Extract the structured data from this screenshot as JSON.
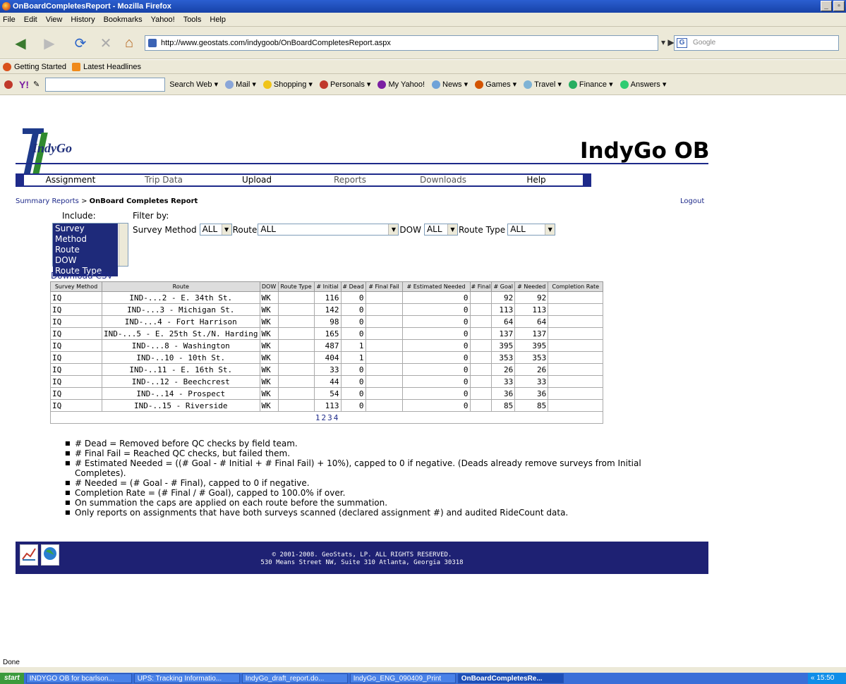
{
  "window": {
    "title": "OnBoardCompletesReport - Mozilla Firefox"
  },
  "menu": [
    "File",
    "Edit",
    "View",
    "History",
    "Bookmarks",
    "Yahoo!",
    "Tools",
    "Help"
  ],
  "toolbar": {
    "url": "http://www.geostats.com/indygoob/OnBoardCompletesReport.aspx",
    "search_placeholder": "Google"
  },
  "bookmarks": [
    "Getting Started",
    "Latest Headlines"
  ],
  "yahoo_toolbar": {
    "search_web": "Search Web",
    "items": [
      "Mail",
      "Shopping",
      "Personals",
      "My Yahoo!",
      "News",
      "Games",
      "Travel",
      "Finance",
      "Answers"
    ]
  },
  "site": {
    "logo_text": "IndyGo",
    "app_title": "IndyGo OB",
    "tabs": [
      "Assignment",
      "Trip Data",
      "Upload",
      "Reports",
      "Downloads",
      "Help"
    ]
  },
  "breadcrumb": {
    "parent": "Summary Reports",
    "sep": ">",
    "current": "OnBoard Completes Report"
  },
  "logout": "Logout",
  "include": {
    "label": "Include:",
    "options": [
      "Survey Method",
      "Route",
      "DOW",
      "Route Type"
    ]
  },
  "filter": {
    "label": "Filter by:",
    "survey_method_label": "Survey Method",
    "survey_method_value": "ALL",
    "route_label": "Route",
    "route_value": "ALL",
    "dow_label": "DOW",
    "dow_value": "ALL",
    "route_type_label": "Route Type",
    "route_type_value": "ALL"
  },
  "download_csv": "Download CSV",
  "table": {
    "headers": [
      "Survey Method",
      "Route",
      "DOW",
      "Route Type",
      "# Initial",
      "# Dead",
      "# Final Fail",
      "# Estimated Needed",
      "# Final",
      "# Goal",
      "# Needed",
      "Completion Rate"
    ],
    "rows": [
      [
        "IQ",
        "IND-...2 - E. 34th St.",
        "WK",
        "",
        "116",
        "0",
        "",
        "0",
        "92",
        "92",
        ""
      ],
      [
        "IQ",
        "IND-...3 - Michigan St.",
        "WK",
        "",
        "142",
        "0",
        "",
        "0",
        "113",
        "113",
        ""
      ],
      [
        "IQ",
        "IND-...4 - Fort Harrison",
        "WK",
        "",
        "98",
        "0",
        "",
        "0",
        "64",
        "64",
        ""
      ],
      [
        "IQ",
        "IND-...5 - E. 25th St./N. Harding",
        "WK",
        "",
        "165",
        "0",
        "",
        "0",
        "137",
        "137",
        ""
      ],
      [
        "IQ",
        "IND-...8 - Washington",
        "WK",
        "",
        "487",
        "1",
        "",
        "0",
        "395",
        "395",
        ""
      ],
      [
        "IQ",
        "IND-..10 - 10th St.",
        "WK",
        "",
        "404",
        "1",
        "",
        "0",
        "353",
        "353",
        ""
      ],
      [
        "IQ",
        "IND-..11 - E. 16th St.",
        "WK",
        "",
        "33",
        "0",
        "",
        "0",
        "26",
        "26",
        ""
      ],
      [
        "IQ",
        "IND-..12 - Beechcrest",
        "WK",
        "",
        "44",
        "0",
        "",
        "0",
        "33",
        "33",
        ""
      ],
      [
        "IQ",
        "IND-..14 - Prospect",
        "WK",
        "",
        "54",
        "0",
        "",
        "0",
        "36",
        "36",
        ""
      ],
      [
        "IQ",
        "IND-..15 - Riverside",
        "WK",
        "",
        "113",
        "0",
        "",
        "0",
        "85",
        "85",
        ""
      ]
    ],
    "pages": [
      "1",
      "2",
      "3",
      "4"
    ]
  },
  "notes": [
    "# Dead = Removed before QC checks by field team.",
    "# Final Fail = Reached QC checks, but failed them.",
    "# Estimated Needed = ((# Goal - # Initial + # Final Fail) + 10%), capped to 0 if negative.  (Deads already remove surveys from Initial Completes).",
    "# Needed = (# Goal - # Final), capped to 0 if negative.",
    "Completion Rate = (# Final / # Goal), capped to 100.0% if over.",
    "On summation the caps are applied on each route before the summation.",
    "Only reports on assignments that have both surveys scanned (declared assignment #) and audited RideCount data."
  ],
  "footer": {
    "line1": "© 2001-2008. GeoStats, LP. ALL RIGHTS RESERVED.",
    "line2": "530 Means Street NW, Suite 310 Atlanta, Georgia 30318"
  },
  "status": "Done",
  "taskbar": {
    "start": "start",
    "tasks": [
      "INDYGO OB for bcarlson...",
      "UPS: Tracking Informatio...",
      "IndyGo_draft_report.do...",
      "IndyGo_ENG_090409_Print",
      "OnBoardCompletesRe..."
    ],
    "clock": "15:50"
  }
}
